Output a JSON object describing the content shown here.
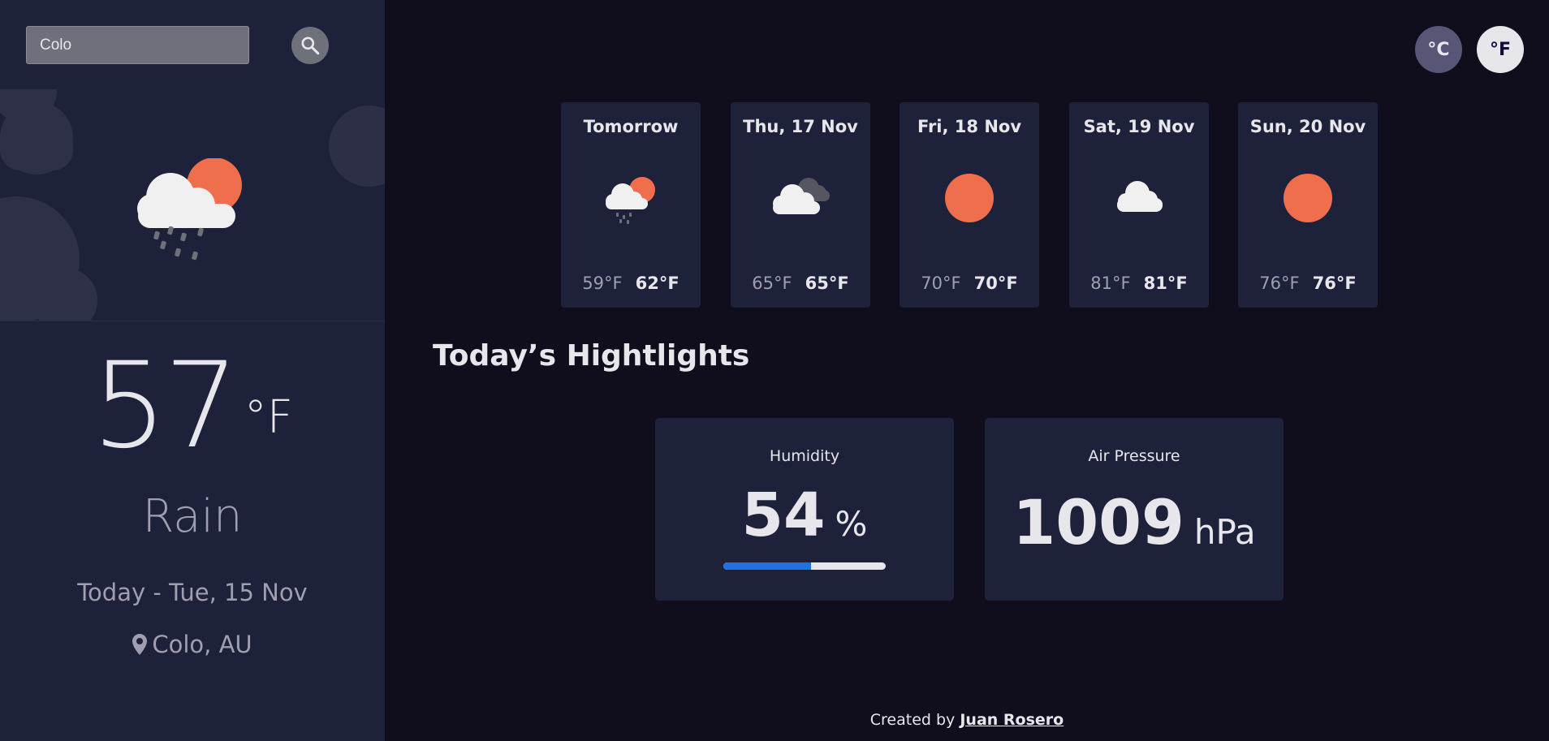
{
  "search": {
    "value": "Colo",
    "icon": "search-icon"
  },
  "current": {
    "icon": "rain-cloud-sun-icon",
    "temperature": "57",
    "unit": "°F",
    "condition": "Rain",
    "date": "Today - Tue, 15 Nov",
    "location": "Colo, AU",
    "location_icon": "map-pin-icon"
  },
  "units": {
    "celsius_label": "°C",
    "fahrenheit_label": "°F"
  },
  "forecast": [
    {
      "day": "Tomorrow",
      "icon": "light-rain-icon",
      "min": "59°F",
      "max": "62°F"
    },
    {
      "day": "Thu, 17 Nov",
      "icon": "broken-clouds-icon",
      "min": "65°F",
      "max": "65°F"
    },
    {
      "day": "Fri, 18 Nov",
      "icon": "clear-sun-icon",
      "min": "70°F",
      "max": "70°F"
    },
    {
      "day": "Sat, 19 Nov",
      "icon": "cloud-icon",
      "min": "81°F",
      "max": "81°F"
    },
    {
      "day": "Sun, 20 Nov",
      "icon": "clear-sun-icon",
      "min": "76°F",
      "max": "76°F"
    }
  ],
  "highlights": {
    "title": "Today’s Hightlights",
    "humidity": {
      "label": "Humidity",
      "value": "54",
      "unit": "%",
      "percent": 54
    },
    "pressure": {
      "label": "Air Pressure",
      "value": "1009",
      "unit": "hPa"
    }
  },
  "footer": {
    "prefix": "Created by ",
    "author": "Juan Rosero"
  },
  "colors": {
    "sidebar_bg": "#1e213a",
    "page_bg": "#100e1d",
    "sun": "#ef6f4d",
    "humidity_fill": "#1a73e8"
  }
}
